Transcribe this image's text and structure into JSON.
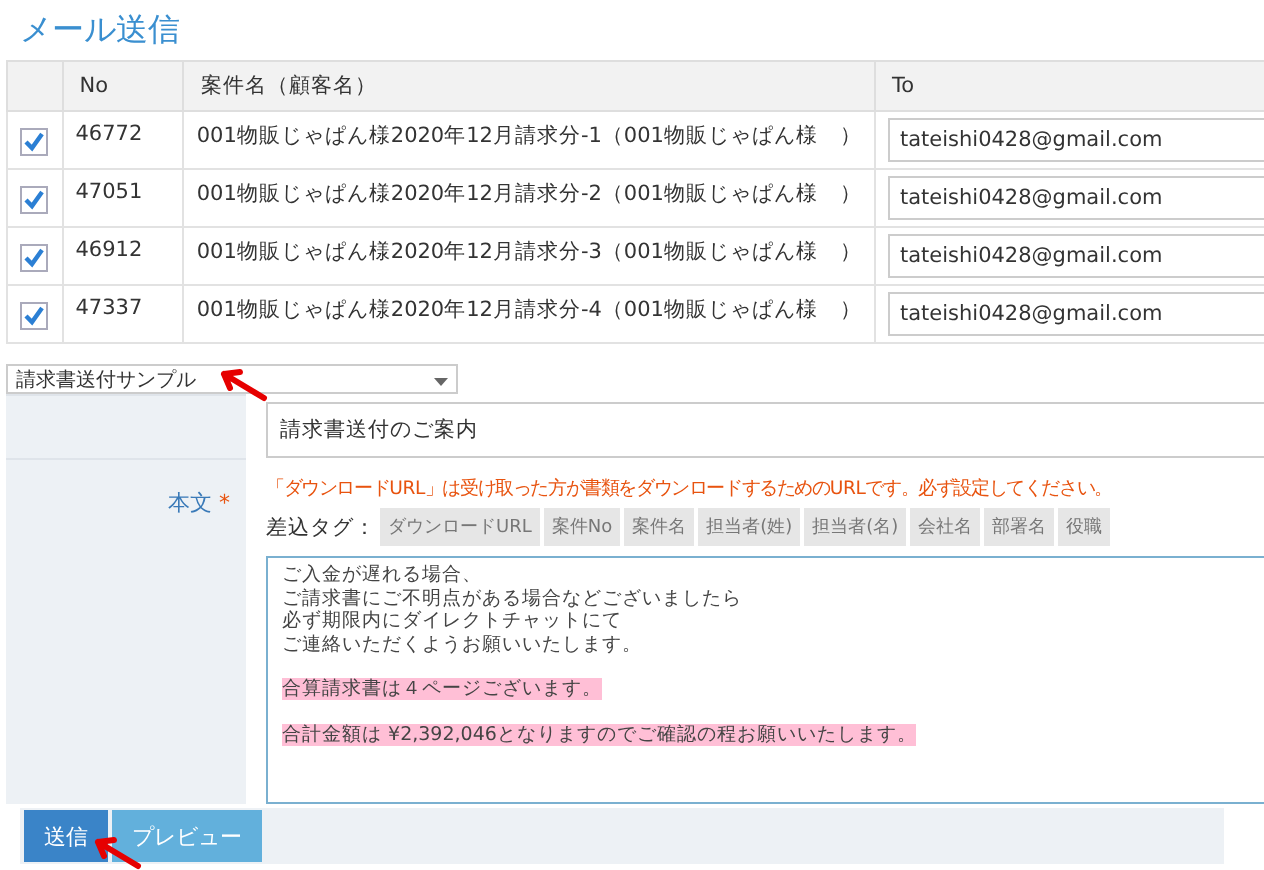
{
  "title": "メール送信",
  "table": {
    "columns": [
      "No",
      "案件名（顧客名）",
      "To"
    ],
    "rows": [
      {
        "checked": true,
        "no": "46772",
        "name": "001物販じゃぱん様2020年12月請求分-1（001物販じゃぱん様　）",
        "to": "tateishi0428@gmail.com"
      },
      {
        "checked": true,
        "no": "47051",
        "name": "001物販じゃぱん様2020年12月請求分-2（001物販じゃぱん様　）",
        "to": "tateishi0428@gmail.com"
      },
      {
        "checked": true,
        "no": "46912",
        "name": "001物販じゃぱん様2020年12月請求分-3（001物販じゃぱん様　）",
        "to": "tateishi0428@gmail.com"
      },
      {
        "checked": true,
        "no": "47337",
        "name": "001物販じゃぱん様2020年12月請求分-4（001物販じゃぱん様　）",
        "to": "tateishi0428@gmail.com"
      }
    ]
  },
  "template_select": {
    "value": "請求書送付サンプル"
  },
  "subject": {
    "value": "請求書送付のご案内"
  },
  "body": {
    "label": "本文",
    "required_mark": "*",
    "notice": "「ダウンロードURL」は受け取った方が書類をダウンロードするためのURLです。必ず設定してください。",
    "tags_label": "差込タグ：",
    "tags": [
      "ダウンロードURL",
      "案件No",
      "案件名",
      "担当者(姓)",
      "担当者(名)",
      "会社名",
      "部署名",
      "役職"
    ],
    "paragraphs": [
      {
        "highlighted": false,
        "lines": [
          "ご入金が遅れる場合、",
          "ご請求書にご不明点がある場合などございましたら",
          "必ず期限内にダイレクトチャットにて",
          "ご連絡いただくようお願いいたします。"
        ]
      },
      {
        "highlighted": true,
        "lines": [
          "合算請求書は４ページございます。"
        ]
      },
      {
        "highlighted": true,
        "lines": [
          "合計金額は ¥2,392,046となりますのでご確認の程お願いいたします。"
        ]
      }
    ]
  },
  "buttons": [
    {
      "label": "送信",
      "kind": "primary"
    },
    {
      "label": "プレビュー",
      "kind": "secondary"
    }
  ]
}
